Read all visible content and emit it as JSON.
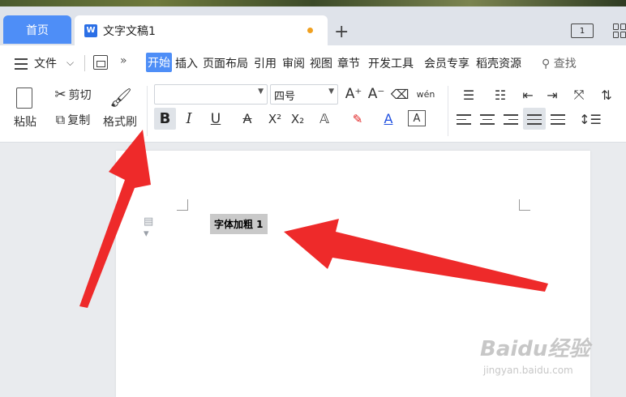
{
  "tabs": {
    "home": "首页",
    "document": "文字文稿1",
    "add": "+",
    "window_icon_label": "1"
  },
  "menu": {
    "file": "文件",
    "more": "»",
    "items": [
      "开始",
      "插入",
      "页面布局",
      "引用",
      "审阅",
      "视图",
      "章节",
      "开发工具",
      "会员专享",
      "稻壳资源"
    ],
    "search": "查找"
  },
  "ribbon": {
    "paste": "粘贴",
    "cut": "剪切",
    "copy": "复制",
    "format_painter": "格式刷",
    "font_name": "",
    "font_size": "四号",
    "bold": "B",
    "italic": "I",
    "underline": "U",
    "pinyin": "wén"
  },
  "document": {
    "selected_text": "字体加粗 1"
  },
  "watermark": {
    "brand": "Baidu经验",
    "url": "jingyan.baidu.com"
  },
  "colors": {
    "accent": "#4e8ef7",
    "annotation_arrow": "#ee2a2a",
    "modified_dot": "#f0a020"
  }
}
